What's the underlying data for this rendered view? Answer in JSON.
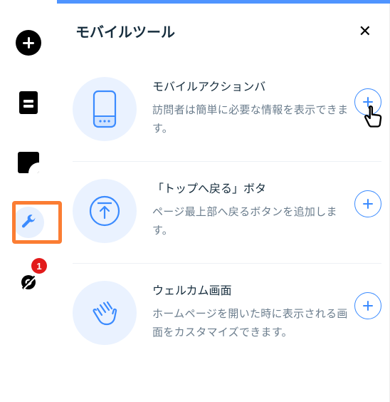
{
  "panel": {
    "title": "モバイルツール"
  },
  "sidebar": {
    "badge": "1"
  },
  "tools": [
    {
      "title": "モバイルアクションバ",
      "desc": "訪問者は簡単に必要な情報を表示できます。"
    },
    {
      "title": "「トップへ戻る」ボタ",
      "desc": "ページ最上部へ戻るボタンを追加します。"
    },
    {
      "title": "ウェルカム画面",
      "desc": "ホームページを開いた時に表示される画面をカスタマイズできます。"
    }
  ]
}
